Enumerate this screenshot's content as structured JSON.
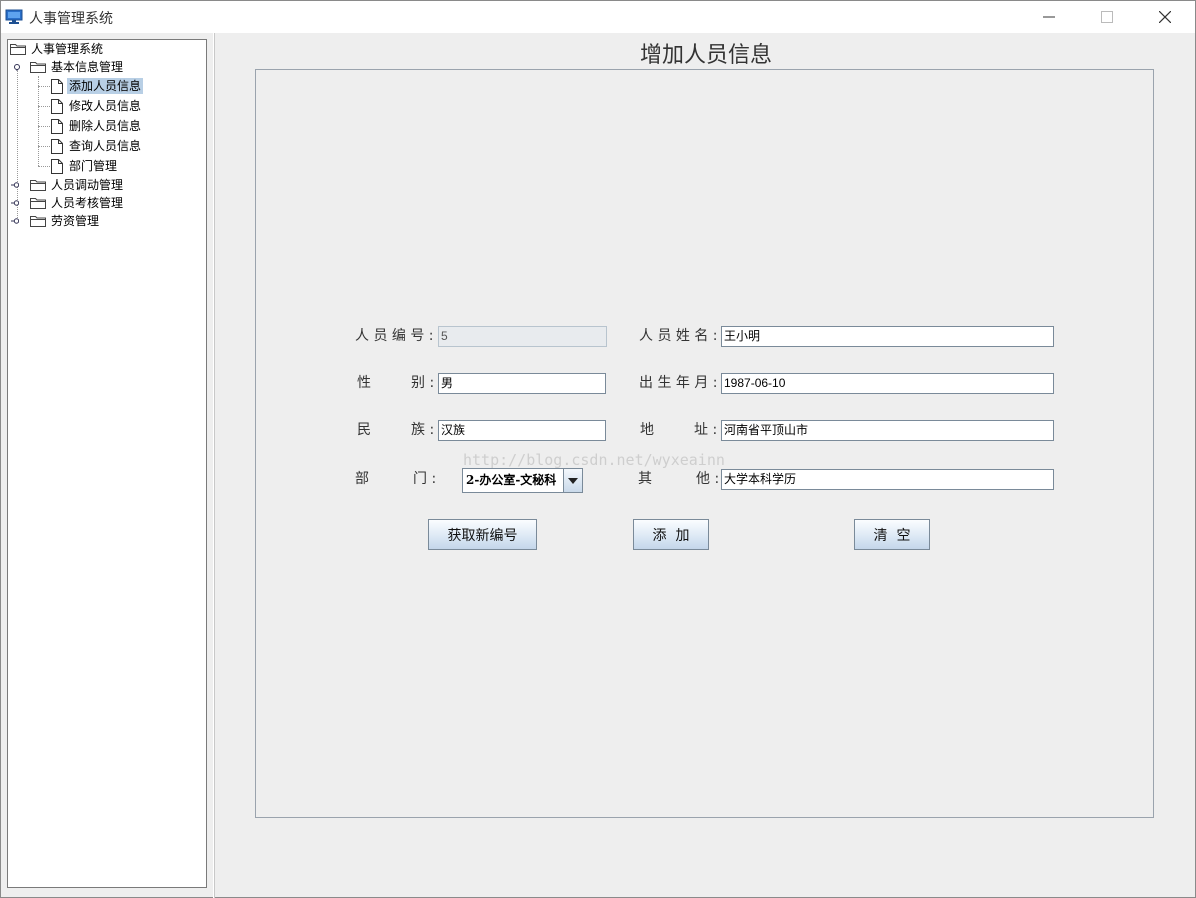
{
  "window": {
    "title": "人事管理系统",
    "controls": {
      "minimize": "minimize-icon",
      "maximize": "maximize-icon",
      "close": "close-icon"
    }
  },
  "tree": {
    "root": "人事管理系统",
    "groups": [
      {
        "label": "基本信息管理",
        "expanded": true,
        "items": [
          "添加人员信息",
          "修改人员信息",
          "删除人员信息",
          "查询人员信息",
          "部门管理"
        ],
        "selected": "添加人员信息"
      },
      {
        "label": "人员调动管理",
        "expanded": false
      },
      {
        "label": "人员考核管理",
        "expanded": false
      },
      {
        "label": "劳资管理",
        "expanded": false
      }
    ]
  },
  "form": {
    "title": "增加人员信息",
    "labels": {
      "id": "人 员 编 号 :",
      "name": "人 员 姓 名 :",
      "gender_a": "性",
      "gender_b": "别 :",
      "birth": "出 生 年 月 :",
      "ethnicity_a": "民",
      "ethnicity_b": "族 :",
      "address_a": "地",
      "address_b": "址 :",
      "dept_a": "部",
      "dept_b": "门 :",
      "other_a": "其",
      "other_b": "他 :"
    },
    "values": {
      "id": "5",
      "name": "王小明",
      "gender": "男",
      "birth": "1987-06-10",
      "ethnicity": "汉族",
      "address": "河南省平顶山市",
      "dept": "2-办公室-文秘科",
      "other": "大学本科学历"
    },
    "buttons": {
      "get_new_id": "获取新编号",
      "add": "添  加",
      "clear": "清  空"
    }
  },
  "watermark": "http://blog.csdn.net/wyxeainn",
  "colors": {
    "selection": "#b8cfe5",
    "panel_bg": "#eeeeee",
    "button_gradient_end": "#c4d6ea"
  }
}
